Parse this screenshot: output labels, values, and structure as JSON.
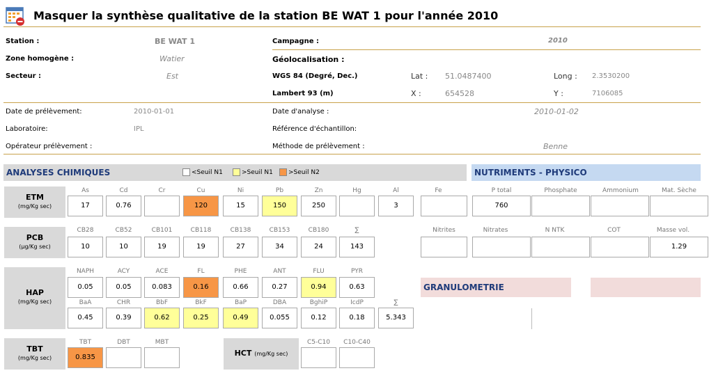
{
  "title": "Masquer la synthèse qualitative de la station BE WAT 1 pour l'année 2010",
  "info": {
    "station_label": "Station :",
    "station": "BE WAT 1",
    "campagne_label": "Campagne :",
    "campagne": "2010",
    "zone_label": "Zone homogène :",
    "zone": "Watier",
    "geo_label": "Géolocalisation :",
    "secteur_label": "Secteur :",
    "secteur": "Est",
    "wgs_label": "WGS 84 (Degré, Dec.)",
    "lat_label": "Lat :",
    "lat": "51.0487400",
    "long_label": "Long :",
    "long": "2.3530200",
    "lambert_label": "Lambert 93 (m)",
    "x_label": "X :",
    "x": "654528",
    "y_label": "Y :",
    "y": "7106085",
    "date_prel_label": "Date de prélèvement:",
    "date_prel": "2010-01-01",
    "date_anal_label": "Date d'analyse :",
    "date_anal": "2010-01-02",
    "labo_label": "Laboratoire:",
    "labo": "IPL",
    "ref_label": "Référence d'échantillon:",
    "oper_label": "Opérateur prélèvement :",
    "methode_label": "Méthode de prélèvement :",
    "methode": "Benne"
  },
  "sections": {
    "chimie": "ANALYSES CHIMIQUES",
    "nutriments": "NUTRIMENTS - PHYSICO",
    "granulo": "GRANULOMETRIE"
  },
  "legend": [
    "<Seuil N1",
    ">Seuil N1",
    ">Seuil N2"
  ],
  "colors": {
    "n1": "#ffff99",
    "n2": "#f79646",
    "rule": "#c8a24a"
  },
  "rows": {
    "etm": {
      "label": "ETM",
      "unit": "(mg/Kg sec)"
    },
    "pcb": {
      "label": "PCB",
      "unit": "(µg/Kg sec)"
    },
    "hap": {
      "label": "HAP",
      "unit": "(mg/Kg sec)"
    },
    "tbt": {
      "label": "TBT",
      "unit": "(mg/Kg sec)"
    },
    "hct": {
      "label": "HCT",
      "unit": "(mg/Kg sec)"
    }
  },
  "etm": {
    "h": [
      "As",
      "Cd",
      "Cr",
      "Cu",
      "Ni",
      "Pb",
      "Zn",
      "Hg",
      "Al",
      "Fe"
    ],
    "v": [
      "17",
      "0.76",
      "",
      "120",
      "15",
      "150",
      "250",
      "",
      "3",
      ""
    ]
  },
  "pcb": {
    "h": [
      "CB28",
      "CB52",
      "CB101",
      "CB118",
      "CB138",
      "CB153",
      "CB180",
      "∑"
    ],
    "v": [
      "10",
      "10",
      "19",
      "19",
      "27",
      "34",
      "24",
      "143"
    ]
  },
  "hap1": {
    "h": [
      "NAPH",
      "ACY",
      "ACE",
      "FL",
      "PHE",
      "ANT",
      "FLU",
      "PYR"
    ],
    "v": [
      "0.05",
      "0.05",
      "0.083",
      "0.16",
      "0.66",
      "0.27",
      "0.94",
      "0.63"
    ]
  },
  "hap2": {
    "h": [
      "BaA",
      "CHR",
      "BbF",
      "BkF",
      "BaP",
      "DBA",
      "BghiP",
      "IcdP",
      "∑"
    ],
    "v": [
      "0.45",
      "0.39",
      "0.62",
      "0.25",
      "0.49",
      "0.055",
      "0.12",
      "0.18",
      "5.343"
    ]
  },
  "tbt": {
    "h": [
      "TBT",
      "DBT",
      "MBT"
    ],
    "v": [
      "0.835",
      "",
      ""
    ]
  },
  "hct": {
    "h": [
      "C5-C10",
      "C10-C40"
    ],
    "v": [
      "",
      ""
    ]
  },
  "nut1": {
    "h": [
      "P total",
      "Phosphate",
      "Ammonium",
      "Mat. Sèche"
    ],
    "v": [
      "760",
      "",
      "",
      ""
    ]
  },
  "nut2": {
    "h": [
      "Nitrites",
      "Nitrates",
      "N NTK",
      "COT",
      "Masse vol."
    ],
    "v": [
      "",
      "",
      "",
      "",
      "1.29"
    ]
  }
}
